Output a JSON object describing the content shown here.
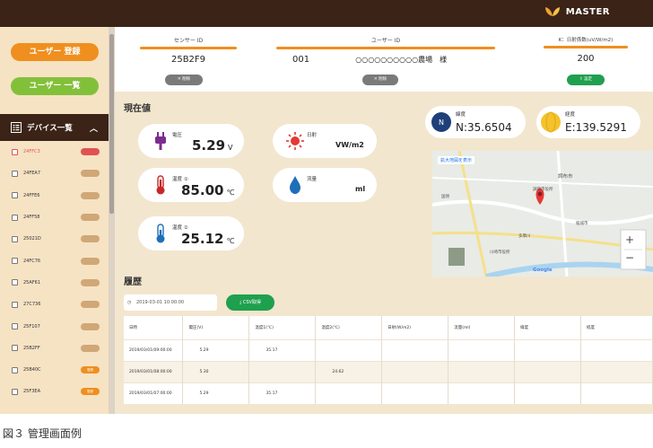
{
  "header": {
    "brand": "MASTER"
  },
  "sidebar": {
    "register_label": "ユーザー 登録",
    "users_label": "ユーザー 一覧",
    "device_list_title": "デバイス一覧",
    "devices": [
      {
        "id": "24FFC3",
        "badge": "",
        "badge_color": "#e05252",
        "active": true
      },
      {
        "id": "24FEA7",
        "badge": "",
        "badge_color": "#d0a777",
        "active": false
      },
      {
        "id": "24FFE6",
        "badge": "",
        "badge_color": "#d0a777",
        "active": false
      },
      {
        "id": "24FF58",
        "badge": "",
        "badge_color": "#d0a777",
        "active": false
      },
      {
        "id": "25021D",
        "badge": "",
        "badge_color": "#d0a777",
        "active": false
      },
      {
        "id": "24FC76",
        "badge": "",
        "badge_color": "#d0a777",
        "active": false
      },
      {
        "id": "25AF61",
        "badge": "",
        "badge_color": "#d0a777",
        "active": false
      },
      {
        "id": "27C736",
        "badge": "",
        "badge_color": "#d0a777",
        "active": false
      },
      {
        "id": "25F107",
        "badge": "",
        "badge_color": "#d0a777",
        "active": false
      },
      {
        "id": "25B2FF",
        "badge": "",
        "badge_color": "#d0a777",
        "active": false
      },
      {
        "id": "25B40C",
        "badge": "登録",
        "badge_color": "#ef8f1f",
        "active": false
      },
      {
        "id": "25F3EA",
        "badge": "登録",
        "badge_color": "#ef8f1f",
        "active": false
      }
    ]
  },
  "info": {
    "sensor_label": "センサー ID",
    "sensor_value": "25B2F9",
    "sensor_btn": "削除",
    "user_label": "ユーザー ID",
    "user_id": "001",
    "user_name": "○○○○○○○○○○農場　様",
    "user_btn": "削除",
    "k_label": "K：日射係数(uV/W/m2)",
    "k_value": "200",
    "k_btn": "設定"
  },
  "current": {
    "title": "現在値",
    "voltage_label": "電圧",
    "voltage_value": "5.29",
    "voltage_unit": "V",
    "temp1_label": "温度 ①",
    "temp1_value": "85.00",
    "temp1_unit": "℃",
    "temp2_label": "温度 ②",
    "temp2_value": "25.12",
    "temp2_unit": "℃",
    "solar_label": "日射",
    "solar_unit": "VW/m2",
    "flow_label": "流量",
    "flow_unit": "ml",
    "lat_label": "緯度",
    "lat_value": "N:35.6504",
    "lat_icon_text": "N",
    "lng_label": "経度",
    "lng_value": "E:139.5291"
  },
  "map": {
    "top_link": "拡大地図を表示",
    "labels": [
      "調布市",
      "調布市役所",
      "稲城市",
      "川崎市役所",
      "国領",
      "多摩川"
    ],
    "logo": "Google",
    "zoom_in": "+",
    "zoom_out": "−"
  },
  "history": {
    "title": "履歴",
    "date_value": "2019-03-01 10:00:00",
    "csv_label": "CSV取得",
    "columns": [
      "日時",
      "電圧(V)",
      "温度1(℃)",
      "温度2(℃)",
      "日射(W/m2)",
      "流量(ml)",
      "緯度",
      "経度"
    ],
    "rows": [
      [
        "2019/03/01/09:00:00",
        "5.29",
        "35.17",
        "",
        "",
        "",
        "",
        ""
      ],
      [
        "2019/03/01/08:00:00",
        "5.30",
        "",
        "24.62",
        "",
        "",
        "",
        ""
      ],
      [
        "2019/03/01/07:00:00",
        "5.29",
        "35.17",
        "",
        "",
        "",
        "",
        ""
      ]
    ]
  },
  "caption": "図３ 管理画面例",
  "colors": {
    "accent": "#ef8f1f",
    "green": "#83c03a",
    "dark": "#3b2417",
    "beige": "#f3e6cf"
  }
}
